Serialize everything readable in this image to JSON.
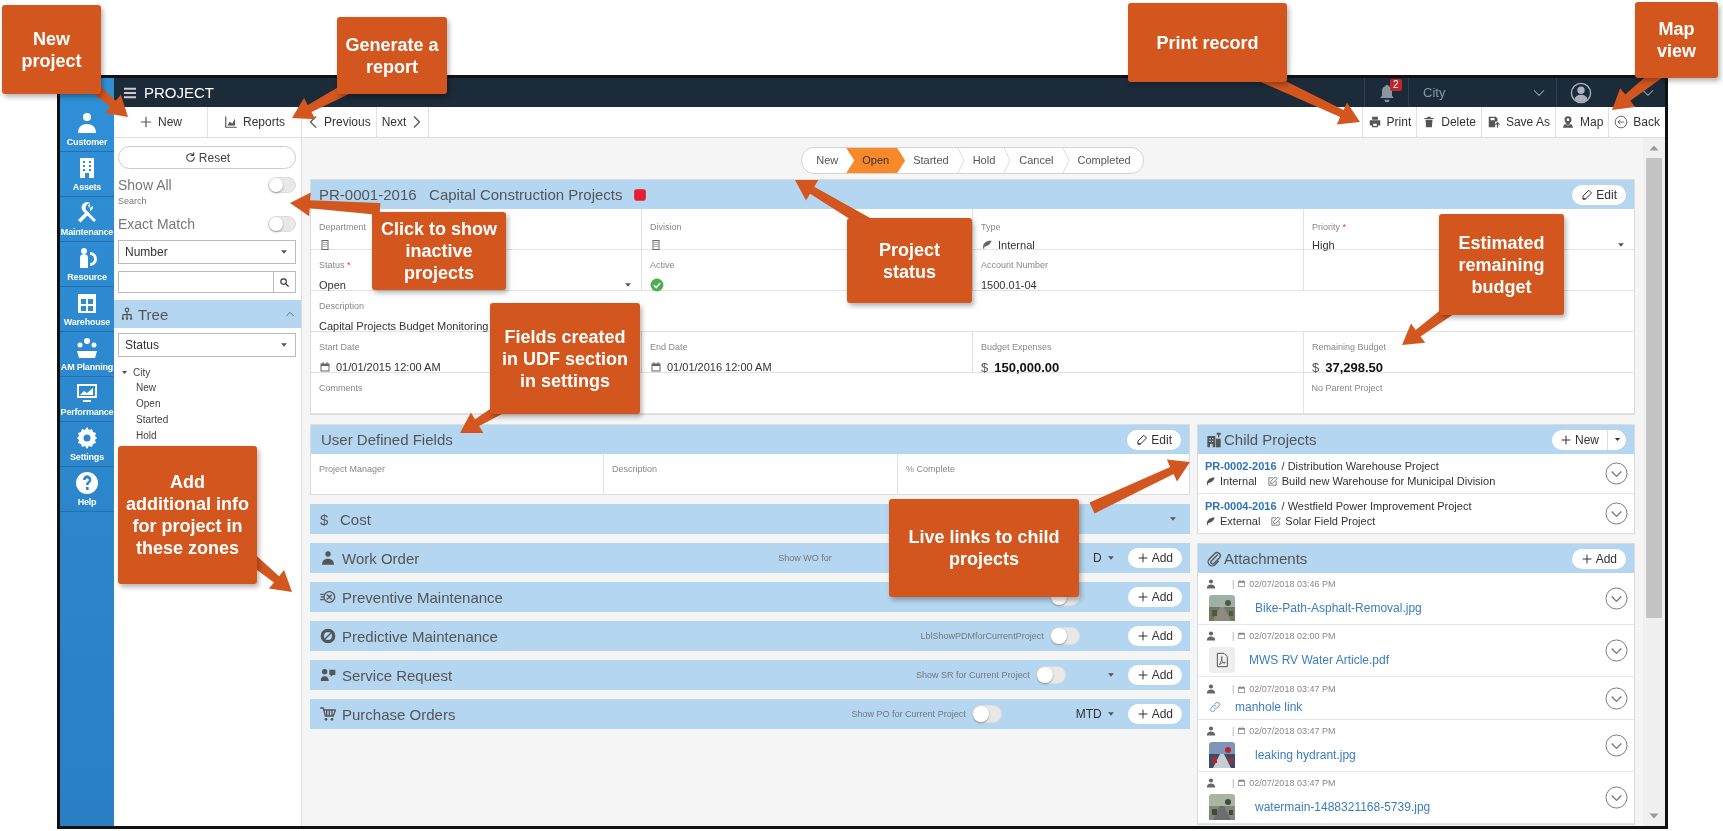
{
  "callouts": [
    {
      "text": "New project"
    },
    {
      "text": "Generate a report"
    },
    {
      "text": "Print record"
    },
    {
      "text": "Map view"
    },
    {
      "text": "Click to show inactive projects"
    },
    {
      "text": "Project status"
    },
    {
      "text": "Fields created in UDF section in settings"
    },
    {
      "text": "Estimated remaining budget"
    },
    {
      "text": "Add additional info for project in these zones"
    },
    {
      "text": "Live links to child projects"
    }
  ],
  "sidebar": [
    {
      "label": "Customer"
    },
    {
      "label": "Assets"
    },
    {
      "label": "Maintenance"
    },
    {
      "label": "Resource"
    },
    {
      "label": "Warehouse"
    },
    {
      "label": "AM Planning"
    },
    {
      "label": "Performance"
    },
    {
      "label": "Settings"
    },
    {
      "label": "Help"
    }
  ],
  "top_bar": {
    "title": "PROJECT",
    "notifications": "2",
    "location": "City"
  },
  "toolbar": {
    "left": [
      {
        "label": "New"
      },
      {
        "label": "Reports"
      }
    ],
    "nav": [
      {
        "label": "Previous"
      },
      {
        "label": "Next"
      }
    ],
    "right": [
      {
        "label": "Print"
      },
      {
        "label": "Delete"
      },
      {
        "label": "Save As"
      },
      {
        "label": "Map"
      },
      {
        "label": "Back"
      }
    ]
  },
  "filters": {
    "reset": "Reset",
    "show_all": {
      "label": "Show All",
      "on": false
    },
    "search_label": "Search",
    "exact_match": {
      "label": "Exact Match",
      "on": false
    },
    "field": "Number",
    "tree_panel": {
      "title": "Tree",
      "expanded": true
    },
    "tree_filter": "Status",
    "tree": [
      {
        "label": "City",
        "expanded": true,
        "children": [
          {
            "label": "New"
          },
          {
            "label": "Open"
          },
          {
            "label": "Started"
          },
          {
            "label": "Hold"
          }
        ]
      }
    ]
  },
  "pipeline": [
    {
      "label": "New",
      "selected": false
    },
    {
      "label": "Open",
      "selected": true
    },
    {
      "label": "Started",
      "selected": false
    },
    {
      "label": "Hold",
      "selected": false
    },
    {
      "label": "Cancel",
      "selected": false
    },
    {
      "label": "Completed",
      "selected": false
    }
  ],
  "project": {
    "number": "PR-0001-2016",
    "name": "Capital Construction Projects",
    "edit": "Edit",
    "rows": [
      [
        {
          "kind": "building",
          "label": "Department"
        },
        {
          "kind": "building",
          "label": "Division"
        },
        {
          "kind": "leaf",
          "label": "Type",
          "value": "Internal"
        },
        {
          "kind": "select",
          "label": "Priority",
          "mark": "*",
          "value": "High"
        }
      ],
      [
        {
          "kind": "select",
          "label": "Status",
          "mark": "*",
          "value": "Open"
        },
        {
          "kind": "check",
          "label": "Active",
          "checked": true
        },
        {
          "kind": "text",
          "label": "Account Number",
          "value": "1500.01-04"
        },
        {
          "kind": "blank"
        }
      ],
      [
        {
          "kind": "text",
          "label": "Description",
          "value": "Capital Projects Budget Monitoring"
        }
      ],
      [
        {
          "kind": "date",
          "label": "Start Date",
          "value": "01/01/2015 12:00 AM"
        },
        {
          "kind": "date",
          "label": "End Date",
          "value": "01/01/2016 12:00 AM"
        },
        {
          "kind": "money",
          "label": "Budget Expenses",
          "currency": "$",
          "value": "150,000.00"
        },
        {
          "kind": "money",
          "label": "Remaining Budget",
          "currency": "$",
          "value": "37,298.50"
        }
      ],
      [
        {
          "kind": "text",
          "label": "Comments"
        },
        {
          "kind": "blank"
        },
        {
          "kind": "blank"
        },
        {
          "kind": "text",
          "label": "No Parent Project"
        }
      ]
    ]
  },
  "udf": {
    "title": "User Defined Fields",
    "edit": "Edit",
    "fields": [
      "Project Manager",
      "Description",
      "% Complete"
    ]
  },
  "bars": [
    {
      "title": "Cost",
      "icon_text": "$",
      "caret": true
    },
    {
      "title": "Work Order",
      "label": "Show WO for",
      "period": "D",
      "caret": true,
      "add": "Add"
    },
    {
      "title": "Preventive Maintenance",
      "toggle_on": false,
      "add": "Add"
    },
    {
      "title": "Predictive Maintenance",
      "label": "LblShowPDMforCurrentProject",
      "toggle_on": false,
      "add": "Add"
    },
    {
      "title": "Service Request",
      "label": "Show SR for Current Project",
      "toggle_on": false,
      "caret": true,
      "add": "Add"
    },
    {
      "title": "Purchase Orders",
      "label": "Show PO for Current Project",
      "toggle_on": false,
      "period": "MTD",
      "caret": true,
      "add": "Add"
    }
  ],
  "child_projects": {
    "title": "Child Projects",
    "new": "New",
    "items": [
      {
        "number": "PR-0002-2016",
        "name": "/ Distribution Warehouse Project",
        "type": "Internal",
        "note": "Build new Warehouse for Municipal Division"
      },
      {
        "number": "PR-0004-2016",
        "name": "/ Westfield Power Improvement Project",
        "type": "External",
        "note": "Solar Field Project"
      }
    ]
  },
  "attachments": {
    "title": "Attachments",
    "add": "Add",
    "items": [
      {
        "divider": "|",
        "date": "02/07/2018 03:46 PM",
        "name": "Bike-Path-Asphalt-Removal.jpg"
      },
      {
        "kind": "pdf",
        "divider": "|",
        "date": "02/07/2018 02:00 PM",
        "name": "MWS RV Water Article.pdf"
      },
      {
        "kind": "link",
        "divider": "|",
        "date": "02/07/2018 03:47 PM",
        "name": "manhole link"
      },
      {
        "divider": "|",
        "date": "02/07/2018 03:47 PM",
        "name": "leaking hydrant.jpg"
      },
      {
        "divider": "|",
        "date": "02/07/2018 03:47 PM",
        "name": "watermain-1488321168-5739.jpg"
      }
    ]
  }
}
